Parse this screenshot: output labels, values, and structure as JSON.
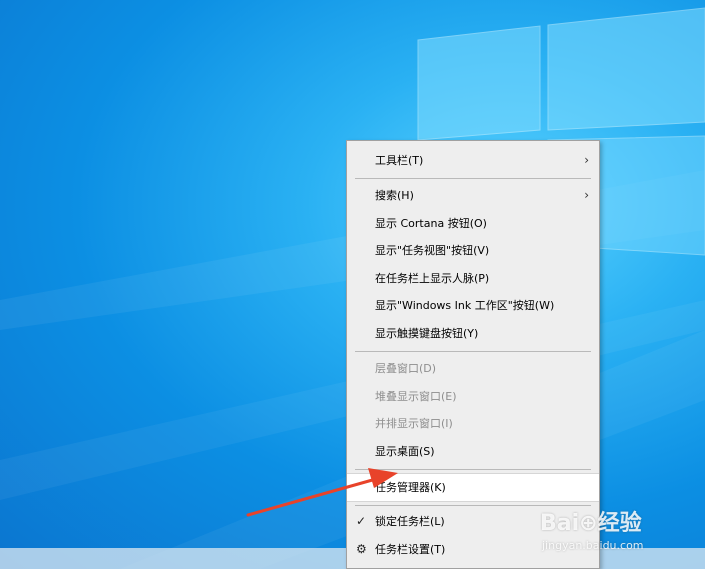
{
  "context_menu": {
    "items": [
      {
        "label": "工具栏(T)",
        "submenu": true,
        "enabled": true
      },
      {
        "label": "搜索(H)",
        "submenu": true,
        "enabled": true
      },
      {
        "label": "显示 Cortana 按钮(O)",
        "enabled": true
      },
      {
        "label": "显示\"任务视图\"按钮(V)",
        "enabled": true
      },
      {
        "label": "在任务栏上显示人脉(P)",
        "enabled": true
      },
      {
        "label": "显示\"Windows Ink 工作区\"按钮(W)",
        "enabled": true
      },
      {
        "label": "显示触摸键盘按钮(Y)",
        "enabled": true
      },
      {
        "label": "层叠窗口(D)",
        "enabled": false
      },
      {
        "label": "堆叠显示窗口(E)",
        "enabled": false
      },
      {
        "label": "并排显示窗口(I)",
        "enabled": false
      },
      {
        "label": "显示桌面(S)",
        "enabled": true
      },
      {
        "label": "任务管理器(K)",
        "enabled": true,
        "highlighted": true
      },
      {
        "label": "锁定任务栏(L)",
        "enabled": true,
        "checked": true
      },
      {
        "label": "任务栏设置(T)",
        "enabled": true,
        "icon": "gear-icon"
      }
    ],
    "submenu_glyph": "›",
    "check_glyph": "✓",
    "gear_glyph": "⚙"
  },
  "annotation": {
    "color": "#e8432a",
    "target": "任务管理器(K)"
  },
  "watermark": {
    "brand": "Bai⊕经验",
    "url": "jingyan.baidu.com"
  },
  "colors": {
    "wallpaper": "#1a9be8",
    "menu_bg": "#eeeeee",
    "highlight_bg": "#ffffff",
    "disabled_text": "#8e8e8e"
  }
}
